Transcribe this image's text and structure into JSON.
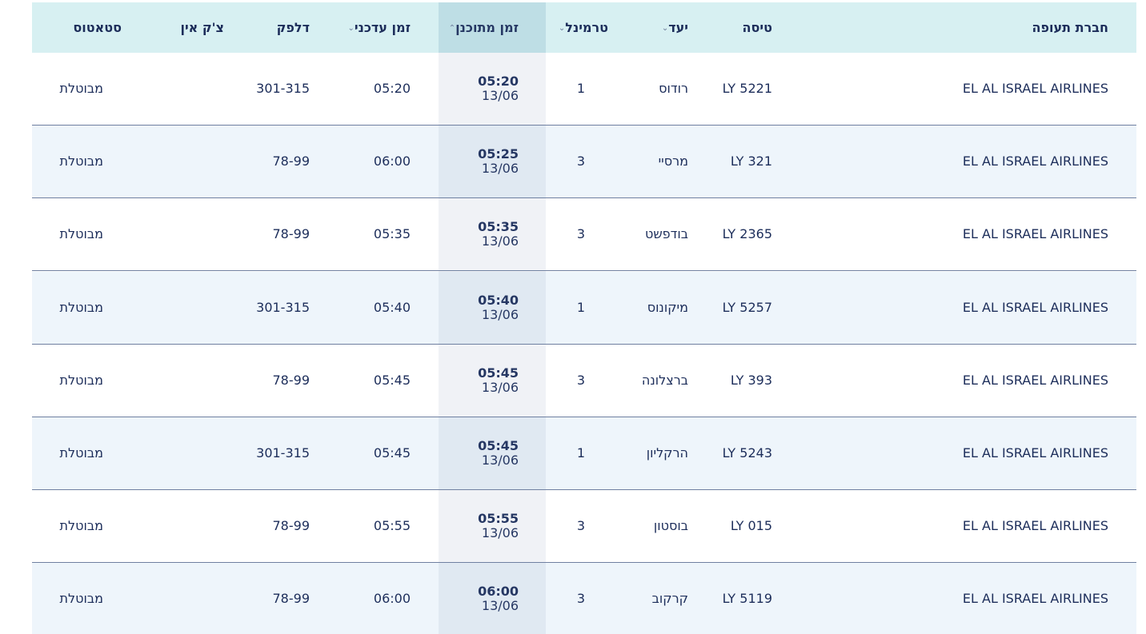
{
  "headers": {
    "airline": "חברת תעופה",
    "flight": "טיסה",
    "destination": "יעד",
    "terminal": "טרמינל",
    "scheduled": "זמן מתוכנן",
    "updated": "זמן עדכני",
    "gate": "דלפק",
    "checkin": "צ'ק אין",
    "status": "סטאטוס"
  },
  "icons": {
    "sort_down": "chevron-down-icon",
    "sort_up": "chevron-up-icon"
  },
  "colors": {
    "header_bg": "#d7f0f2",
    "text": "#1c2d5a",
    "row_alt": "#eef5fb"
  },
  "flights": [
    {
      "airline": "EL AL ISRAEL AIRLINES",
      "flight": "LY 5221",
      "destination": "רודוס",
      "terminal": "1",
      "scheduled_time": "05:20",
      "scheduled_date": "13/06",
      "updated": "05:20",
      "gate": "301-315",
      "checkin": "",
      "status": "מבוטלת"
    },
    {
      "airline": "EL AL ISRAEL AIRLINES",
      "flight": "LY 321",
      "destination": "מרסיי",
      "terminal": "3",
      "scheduled_time": "05:25",
      "scheduled_date": "13/06",
      "updated": "06:00",
      "gate": "78-99",
      "checkin": "",
      "status": "מבוטלת"
    },
    {
      "airline": "EL AL ISRAEL AIRLINES",
      "flight": "LY 2365",
      "destination": "בודפשט",
      "terminal": "3",
      "scheduled_time": "05:35",
      "scheduled_date": "13/06",
      "updated": "05:35",
      "gate": "78-99",
      "checkin": "",
      "status": "מבוטלת"
    },
    {
      "airline": "EL AL ISRAEL AIRLINES",
      "flight": "LY 5257",
      "destination": "מיקונוס",
      "terminal": "1",
      "scheduled_time": "05:40",
      "scheduled_date": "13/06",
      "updated": "05:40",
      "gate": "301-315",
      "checkin": "",
      "status": "מבוטלת"
    },
    {
      "airline": "EL AL ISRAEL AIRLINES",
      "flight": "LY 393",
      "destination": "ברצלונה",
      "terminal": "3",
      "scheduled_time": "05:45",
      "scheduled_date": "13/06",
      "updated": "05:45",
      "gate": "78-99",
      "checkin": "",
      "status": "מבוטלת"
    },
    {
      "airline": "EL AL ISRAEL AIRLINES",
      "flight": "LY 5243",
      "destination": "הרקליון",
      "terminal": "1",
      "scheduled_time": "05:45",
      "scheduled_date": "13/06",
      "updated": "05:45",
      "gate": "301-315",
      "checkin": "",
      "status": "מבוטלת"
    },
    {
      "airline": "EL AL ISRAEL AIRLINES",
      "flight": "LY 015",
      "destination": "בוסטון",
      "terminal": "3",
      "scheduled_time": "05:55",
      "scheduled_date": "13/06",
      "updated": "05:55",
      "gate": "78-99",
      "checkin": "",
      "status": "מבוטלת"
    },
    {
      "airline": "EL AL ISRAEL AIRLINES",
      "flight": "LY 5119",
      "destination": "קרקוב",
      "terminal": "3",
      "scheduled_time": "06:00",
      "scheduled_date": "13/06",
      "updated": "06:00",
      "gate": "78-99",
      "checkin": "",
      "status": "מבוטלת"
    }
  ]
}
